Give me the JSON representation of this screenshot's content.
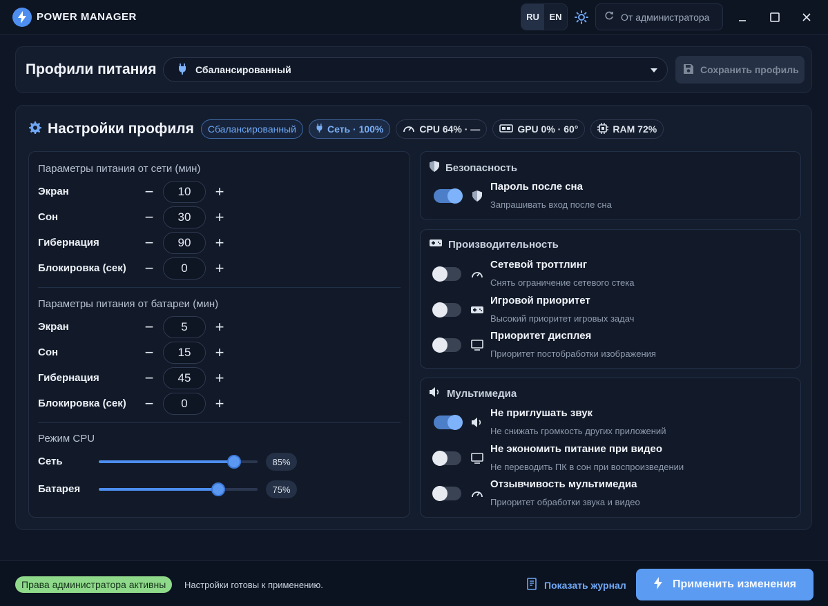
{
  "app": {
    "title": "POWER MANAGER"
  },
  "topbar": {
    "lang_ru": "RU",
    "lang_en": "EN",
    "admin_label": "От администратора"
  },
  "profiles": {
    "title": "Профили питания",
    "selected": "Сбалансированный",
    "save_label": "Сохранить профиль"
  },
  "settings": {
    "title": "Настройки профиля",
    "chips": {
      "profile": "Сбалансированный",
      "power": "Сеть · 100%",
      "cpu": "CPU 64% · —",
      "gpu": "GPU 0% · 60°",
      "ram": "RAM 72%"
    },
    "ac": {
      "title": "Параметры питания от сети (мин)",
      "rows": [
        {
          "label": "Экран",
          "value": "10"
        },
        {
          "label": "Сон",
          "value": "30"
        },
        {
          "label": "Гибернация",
          "value": "90"
        },
        {
          "label": "Блокировка (сек)",
          "value": "0"
        }
      ]
    },
    "battery": {
      "title": "Параметры питания от батареи (мин)",
      "rows": [
        {
          "label": "Экран",
          "value": "5"
        },
        {
          "label": "Сон",
          "value": "15"
        },
        {
          "label": "Гибернация",
          "value": "45"
        },
        {
          "label": "Блокировка (сек)",
          "value": "0"
        }
      ]
    },
    "cpu_mode": {
      "title": "Режим CPU",
      "rows": [
        {
          "label": "Сеть",
          "value": 85,
          "text": "85%"
        },
        {
          "label": "Батарея",
          "value": 75,
          "text": "75%"
        }
      ]
    }
  },
  "security": {
    "title": "Безопасность",
    "options": [
      {
        "title": "Пароль после сна",
        "subtitle": "Запрашивать вход после сна",
        "on": true,
        "icon": "shield-icon"
      }
    ]
  },
  "performance": {
    "title": "Производительность",
    "options": [
      {
        "title": "Сетевой троттлинг",
        "subtitle": "Снять ограничение сетевого стека",
        "on": false,
        "icon": "gauge-icon"
      },
      {
        "title": "Игровой приоритет",
        "subtitle": "Высокий приоритет игровых задач",
        "on": false,
        "icon": "gamepad-icon"
      },
      {
        "title": "Приоритет дисплея",
        "subtitle": "Приоритет постобработки изображения",
        "on": false,
        "icon": "monitor-icon"
      }
    ]
  },
  "multimedia": {
    "title": "Мультимедиа",
    "options": [
      {
        "title": "Не приглушать звук",
        "subtitle": "Не снижать громкость других приложений",
        "on": true,
        "icon": "speaker-icon"
      },
      {
        "title": "Не экономить питание при видео",
        "subtitle": "Не переводить ПК в сон при воспроизведении",
        "on": false,
        "icon": "monitor-icon"
      },
      {
        "title": "Отзывчивость мультимедиа",
        "subtitle": "Приоритет обработки звука и видео",
        "on": false,
        "icon": "gauge-icon"
      }
    ]
  },
  "footer": {
    "admin_badge": "Права администратора активны",
    "status": "Настройки готовы к применению.",
    "journal_label": "Показать журнал",
    "apply_label": "Применить изменения"
  },
  "colors": {
    "accent": "#4d8ef0",
    "background": "#0f1726",
    "success": "#8fd98a"
  }
}
